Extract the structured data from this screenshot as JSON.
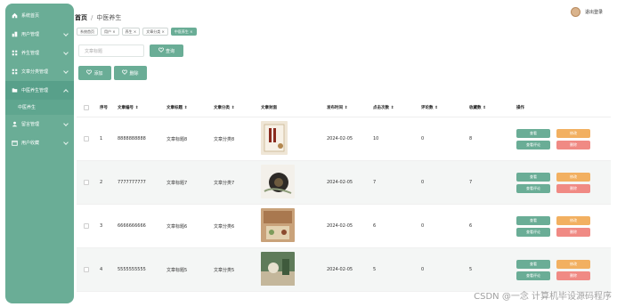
{
  "sidebar": {
    "items": [
      {
        "label": "系统首页",
        "icon": "home-icon",
        "expandable": false
      },
      {
        "label": "用户管理",
        "icon": "user-manage-icon",
        "expandable": true
      },
      {
        "label": "养生管理",
        "icon": "grid-icon",
        "expandable": true
      },
      {
        "label": "文章分类管理",
        "icon": "grid-icon",
        "expandable": true
      },
      {
        "label": "中医养生管理",
        "icon": "folder-icon",
        "expandable": true,
        "active": true
      },
      {
        "label": "留言管理",
        "icon": "person-icon",
        "expandable": true
      },
      {
        "label": "用户收藏",
        "icon": "calendar-icon",
        "expandable": true
      }
    ],
    "subitem": "中医养生"
  },
  "breadcrumb": {
    "home": "首页",
    "sep": "/",
    "current": "中医养生"
  },
  "header": {
    "logout": "退出登录"
  },
  "tags": [
    {
      "label": "系统首页",
      "active": false
    },
    {
      "label": "用户 ×",
      "active": false
    },
    {
      "label": "养生 ×",
      "active": false
    },
    {
      "label": "文章分类 ×",
      "active": false
    },
    {
      "label": "中医养生 ×",
      "active": true
    }
  ],
  "search": {
    "placeholder": "文章标题",
    "button": "查询"
  },
  "actions": {
    "add": "添加",
    "delete": "删除"
  },
  "table": {
    "headers": [
      "序号",
      "文章编号 ⇕",
      "文章标题 ⇕",
      "文章分类 ⇕",
      "文章封面",
      "发布时间 ⇕",
      "点击次数 ⇕",
      "评论数 ⇕",
      "收藏数 ⇕",
      "操作"
    ],
    "rows": [
      {
        "idx": "1",
        "code": "8888888888",
        "title": "文章标题8",
        "category": "文章分类8",
        "date": "2024-02-05",
        "clicks": "10",
        "comments": "0",
        "favs": "8"
      },
      {
        "idx": "2",
        "code": "7777777777",
        "title": "文章标题7",
        "category": "文章分类7",
        "date": "2024-02-05",
        "clicks": "7",
        "comments": "0",
        "favs": "7"
      },
      {
        "idx": "3",
        "code": "6666666666",
        "title": "文章标题6",
        "category": "文章分类6",
        "date": "2024-02-05",
        "clicks": "6",
        "comments": "0",
        "favs": "6"
      },
      {
        "idx": "4",
        "code": "5555555555",
        "title": "文章标题5",
        "category": "文章分类5",
        "date": "2024-02-05",
        "clicks": "5",
        "comments": "0",
        "favs": "5"
      }
    ],
    "ops": {
      "view": "查看",
      "edit": "修改",
      "review": "查看评论",
      "del": "删除"
    }
  },
  "watermark": "CSDN @一念 计算机毕设源码程序",
  "colors": {
    "primary": "#6aad96",
    "warning": "#f2b061",
    "danger": "#f08a84"
  }
}
